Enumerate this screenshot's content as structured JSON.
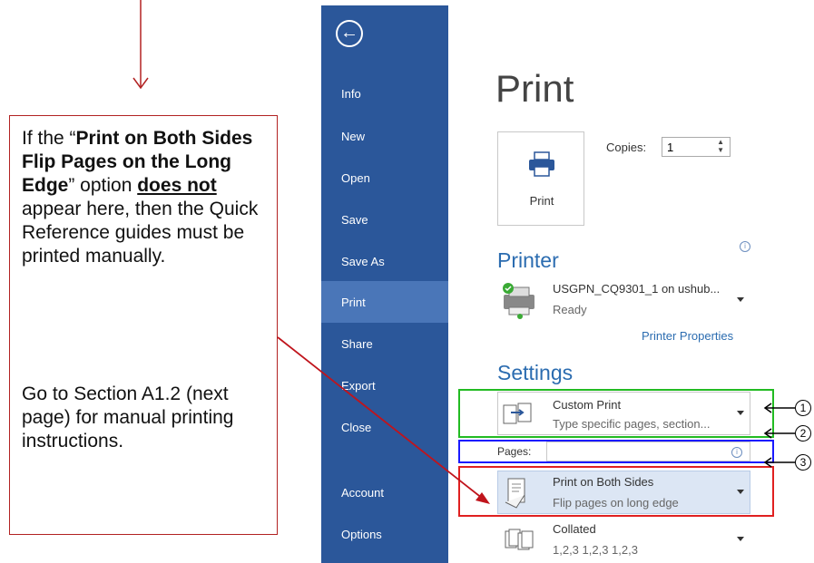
{
  "callout": {
    "line1_prefix": "If the “",
    "line1_bold": "Print on Both Sides Flip Pages on the Long Edge",
    "line1_suffix": "” option ",
    "does_not": "does not",
    "line1_rest": " appear here, then the Quick Reference guides must be printed manually.",
    "line2": "Go to Section A1.2 (next page) for manual printing instructions."
  },
  "sidebar": {
    "back_icon": "←",
    "items": [
      {
        "label": "Info"
      },
      {
        "label": "New"
      },
      {
        "label": "Open"
      },
      {
        "label": "Save"
      },
      {
        "label": "Save As"
      },
      {
        "label": "Print"
      },
      {
        "label": "Share"
      },
      {
        "label": "Export"
      },
      {
        "label": "Close"
      },
      {
        "label": "Account"
      },
      {
        "label": "Options"
      }
    ]
  },
  "main": {
    "title": "Print",
    "print_button_label": "Print",
    "copies_label": "Copies:",
    "copies_value": "1",
    "printer_heading": "Printer",
    "printer_name": "USGPN_CQ9301_1 on ushub...",
    "printer_status": "Ready",
    "printer_properties": "Printer Properties",
    "settings_heading": "Settings",
    "setting_custom_title": "Custom Print",
    "setting_custom_sub": "Type specific pages, section...",
    "pages_label": "Pages:",
    "pages_value": "",
    "setting_duplex_title": "Print on Both Sides",
    "setting_duplex_sub": "Flip pages on long edge",
    "setting_collate_title": "Collated",
    "setting_collate_sub": "1,2,3   1,2,3   1,2,3"
  },
  "annotations": [
    "1",
    "2",
    "3"
  ],
  "colors": {
    "sidebar": "#2b579a",
    "sidebar_selected": "#4a76b8",
    "heading_blue": "#2b6cb0",
    "callout_border": "#b22222",
    "box_green": "#22bb22",
    "box_blue": "#1a1aff",
    "box_red": "#e02020"
  }
}
